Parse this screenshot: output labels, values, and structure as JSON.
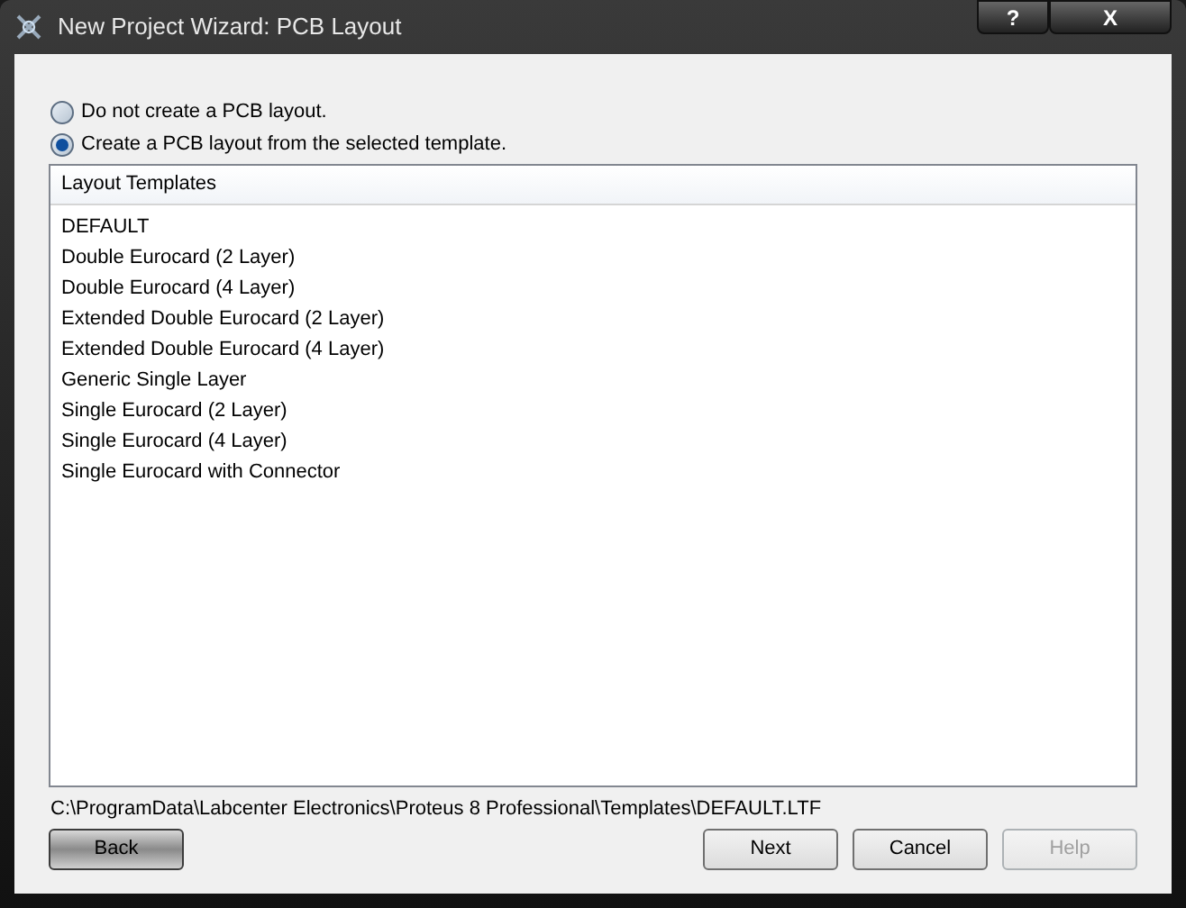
{
  "window": {
    "title": "New Project Wizard: PCB Layout",
    "controls": [
      "?",
      "X"
    ]
  },
  "options": [
    {
      "label": "Do not create a PCB layout.",
      "selected": false
    },
    {
      "label": "Create a PCB layout from the selected template.",
      "selected": true
    }
  ],
  "list": {
    "header": "Layout Templates",
    "items": [
      "DEFAULT",
      "Double Eurocard (2 Layer)",
      "Double Eurocard (4 Layer)",
      "Extended Double Eurocard (2 Layer)",
      "Extended Double Eurocard (4 Layer)",
      "Generic Single Layer",
      "Single Eurocard (2 Layer)",
      "Single Eurocard (4 Layer)",
      "Single Eurocard with Connector"
    ]
  },
  "path": "C:\\ProgramData\\Labcenter Electronics\\Proteus 8 Professional\\Templates\\DEFAULT.LTF",
  "buttons": [
    {
      "label": "Back",
      "disabled": false
    },
    {
      "label": "Next",
      "disabled": false
    },
    {
      "label": "Cancel",
      "disabled": false
    },
    {
      "label": "Help",
      "disabled": true
    }
  ]
}
